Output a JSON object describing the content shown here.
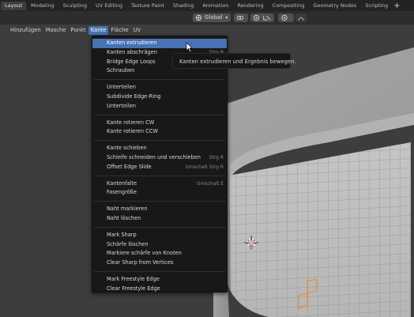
{
  "workspace_tabs": [
    {
      "label": "Layout",
      "active": true
    },
    {
      "label": "Modeling",
      "active": false
    },
    {
      "label": "Sculpting",
      "active": false
    },
    {
      "label": "UV Editing",
      "active": false
    },
    {
      "label": "Texture Paint",
      "active": false
    },
    {
      "label": "Shading",
      "active": false
    },
    {
      "label": "Animation",
      "active": false
    },
    {
      "label": "Rendering",
      "active": false
    },
    {
      "label": "Compositing",
      "active": false
    },
    {
      "label": "Geometry Nodes",
      "active": false
    },
    {
      "label": "Scripting",
      "active": false
    }
  ],
  "add_workspace": "+",
  "toolbar": {
    "orientation": "Global"
  },
  "menubar": [
    {
      "label": "Hinzufügen",
      "active": false
    },
    {
      "label": "Masche",
      "active": false
    },
    {
      "label": "Punkt",
      "active": false
    },
    {
      "label": "Kante",
      "active": true
    },
    {
      "label": "Fläche",
      "active": false
    },
    {
      "label": "UV",
      "active": false
    }
  ],
  "dropdown": {
    "groups": [
      [
        {
          "label": "Kanten extrudieren",
          "shortcut": "",
          "highlight": true
        },
        {
          "label": "Kanten abschrägen",
          "shortcut": "Strg B",
          "highlight": false
        },
        {
          "label": "Bridge Edge Loops",
          "shortcut": "",
          "highlight": false
        },
        {
          "label": "Schrauben",
          "shortcut": "",
          "highlight": false
        }
      ],
      [
        {
          "label": "Unterteilen",
          "shortcut": "",
          "highlight": false
        },
        {
          "label": "Subdivide Edge-Ring",
          "shortcut": "",
          "highlight": false
        },
        {
          "label": "Unterteilen",
          "shortcut": "",
          "highlight": false
        }
      ],
      [
        {
          "label": "Kante rotieren CW",
          "shortcut": "",
          "highlight": false
        },
        {
          "label": "Kante rotieren CCW",
          "shortcut": "",
          "highlight": false
        }
      ],
      [
        {
          "label": "Kante schieben",
          "shortcut": "",
          "highlight": false
        },
        {
          "label": "Schleife schneiden und verschieben",
          "shortcut": "Strg R",
          "highlight": false
        },
        {
          "label": "Offset Edge Slide",
          "shortcut": "Umschalt Strg R",
          "highlight": false
        }
      ],
      [
        {
          "label": "Kantenfalte",
          "shortcut": "Umschalt E",
          "highlight": false
        },
        {
          "label": "Fasengröße",
          "shortcut": "",
          "highlight": false
        }
      ],
      [
        {
          "label": "Naht markieren",
          "shortcut": "",
          "highlight": false
        },
        {
          "label": "Naht löschen",
          "shortcut": "",
          "highlight": false
        }
      ],
      [
        {
          "label": "Mark Sharp",
          "shortcut": "",
          "highlight": false
        },
        {
          "label": "Schärfe löschen",
          "shortcut": "",
          "highlight": false
        },
        {
          "label": "Markiere schärfe von Knoten",
          "shortcut": "",
          "highlight": false
        },
        {
          "label": "Clear Sharp from Vertices",
          "shortcut": "",
          "highlight": false
        }
      ],
      [
        {
          "label": "Mark Freestyle Edge",
          "shortcut": "",
          "highlight": false
        },
        {
          "label": "Clear Freestyle Edge",
          "shortcut": "",
          "highlight": false
        }
      ]
    ]
  },
  "tooltip": "Kanten extrudieren und Ergebnis bewegen.",
  "colors": {
    "accent": "#4772b3",
    "cube_face": "#bfbfbf",
    "cube_grid": "#8f8f8f",
    "selection": "#f08a20"
  },
  "icons": [
    "orientation-icon",
    "pivot-icon",
    "snap-icon",
    "proportional-icon",
    "falloff-icon",
    "mouse-cursor-icon",
    "3d-cursor-icon"
  ]
}
